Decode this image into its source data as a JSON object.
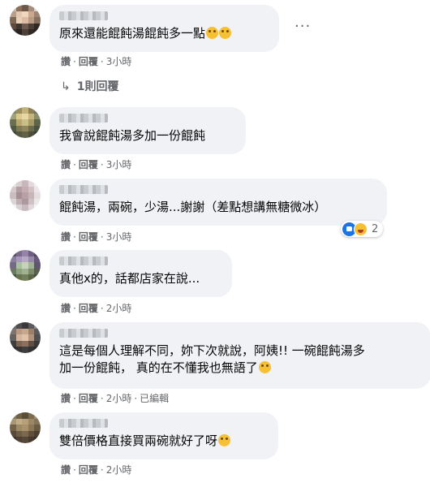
{
  "comments": [
    {
      "text": "原來還能餛飩湯餛飩多一點",
      "emojis": [
        "thinking-face-icon",
        "thinking-face-icon"
      ],
      "meta": {
        "like": "讚",
        "reply": "回覆",
        "time": "3小時",
        "edited": null
      }
    },
    {
      "text": "我會說餛飩湯多加一份餛飩",
      "emojis": [],
      "meta": {
        "like": "讚",
        "reply": "回覆",
        "time": "3小時",
        "edited": null
      }
    },
    {
      "text": "餛飩湯，兩碗，少湯...謝謝（差點想講無糖微冰）",
      "emojis": [],
      "reactions": {
        "icons": [
          "like-reaction-icon",
          "haha-reaction-icon"
        ],
        "count": "2"
      },
      "meta": {
        "like": "讚",
        "reply": "回覆",
        "time": "3小時",
        "edited": null
      }
    },
    {
      "text": "真他x的，話都店家在說...",
      "emojis": [],
      "meta": {
        "like": "讚",
        "reply": "回覆",
        "time": "2小時",
        "edited": null
      }
    },
    {
      "text_lines": [
        "這是每個人理解不同，妳下次就說，阿姨!! 一碗餛飩湯多",
        "加一份餛飩， 真的在不懂我也無語了"
      ],
      "emojis": [
        "rolling-on-floor-laughing-icon"
      ],
      "meta": {
        "like": "讚",
        "reply": "回覆",
        "time": "2小時",
        "edited": "已編輯"
      }
    },
    {
      "text": "雙倍價格直接買兩碗就好了呀",
      "emojis": [
        "thinking-face-icon"
      ],
      "meta": {
        "like": "讚",
        "reply": "回覆",
        "time": "2小時",
        "edited": null
      }
    }
  ],
  "replies_link": "1則回覆",
  "sep": "·",
  "more_label": "···",
  "colors": {
    "bubble": "#f0f2f5",
    "meta": "#65676b",
    "text": "#050505"
  }
}
